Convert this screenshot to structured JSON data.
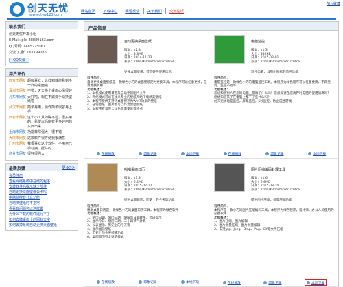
{
  "header": {
    "logo_name": "创天无忧",
    "logo_url": "www.ctwy123.com",
    "nav": [
      "网站首页",
      "下载中心",
      "问题反馈",
      "关于我们",
      "交流论坛"
    ],
    "join_label": "加入收藏"
  },
  "contact": {
    "title": "联系我们",
    "lines": [
      "创天无忧开发小组",
      "E-Mail: ple_88889163.com",
      "QQ号码: 1485225067",
      "交流QQ群: 167799086"
    ],
    "qq_button": "QQ交谈"
  },
  "reviews": {
    "title": "用户评价",
    "items": [
      {
        "name": "西安市网友",
        "text": "超级喜欢，这样到就能看到不一样的桌面啦"
      },
      {
        "name": "深圳市网友",
        "text": "不错，天天换个桌面心情很好"
      },
      {
        "name": "丹东市网友",
        "text": "太好啦，现在不需要手动换壁纸啦"
      },
      {
        "name": "武汉市网友",
        "text": "简单易用，操作简单很容易上手"
      },
      {
        "name": "西安市网友",
        "text": "这个小工具的确不错，很实用的，希望以后能有更多好用的东西出来"
      },
      {
        "name": "上海市网友",
        "text": "功能非常强大，很不错"
      },
      {
        "name": "大庆市网友",
        "text": "这款软件很方便我很满意"
      },
      {
        "name": "广州市网友",
        "text": "我很喜欢这个软件，不用自己手动换，挺好的"
      },
      {
        "name": "商业市网友",
        "text": "很好很强大"
      }
    ]
  },
  "feedback": {
    "title": "最新反馈",
    "more": "更多>>",
    "items": [
      "会员注册",
      "查看网络系统中在线的程序",
      "安装软件后提示缺少部件",
      "自动更换桌面壁纸会卡吗",
      "电脑监控有什么功能",
      "自动换壁纸时不正常",
      "看看有问题可以这样做",
      "为什么下载的软件运行不了",
      "如何去掉桌面上的图标文字",
      "如何去掉系统自动更换桌面壁纸"
    ]
  },
  "main": {
    "title": "产品信息",
    "products": [
      {
        "name": "自动更换桌面壁纸",
        "specs": [
          "版本：v2.3",
          "大小：3.8MB",
          "日期：2014-11-23",
          "系统：2000/XP/Vista/Win7/Win8"
        ],
        "tagline": "更换桌面壁纸，营造硬件使用信息",
        "desc_title": "程序简介：",
        "desc": "自动更换桌面壁纸是一款绿色小巧的桌面壁纸定时更换工具，本程序可以任意更换，任意更换所用",
        "feat_title": "功能概述：",
        "features": [
          "1、本机模式使用日志及自动更新图片文件",
          "2、网络模式可以在线从专业的壁纸网站下载精美壁纸",
          "3、本程序提供支持将桌面保存为Win7效果的壁纸",
          "4、任何壁纸、图片都可以作为桌面壁纸",
          "5、本程序有着完全绿色无需安装等特点"
        ],
        "actions": [
          "在线播放",
          "印象记录",
          "本地下载"
        ]
      },
      {
        "name": "电脑监控",
        "specs": [
          "版本：v1.3",
          "大小：832KB",
          "日期：2015-03-01",
          "系统：2000/XP/Vista/Win7/Win8"
        ],
        "tagline": "监控电脑，具有小图标的监控功能",
        "desc_title": "程序简介：",
        "desc": "电脑监控是一款绿色小巧的电脑监控工具，本程序为绿色程序可以任意更换，不再受到，监控不错等",
        "feat_title": "功能概述：",
        "features": [
          "您想知道别人在您的电脑上都做了什么吗？您想知道在您离开时电脑的使用情况吗？",
          "您想知道孩子在电脑上都干了些什么吗？",
          "创天无忧电脑监控，屏幕监控，5秒监控，防止沉迷游戏"
        ],
        "actions": [
          "在线播放",
          "印象记录",
          "本地下载"
        ]
      },
      {
        "name": "唱唱桌面日历",
        "specs": [
          "版本：v1.3",
          "大小：2.6MB",
          "日期：2015-02-17",
          "系统：2000/XP/Vista/Win7/Win8"
        ],
        "tagline": "提供桌面日历，历史上的今天等功能",
        "desc_title": "程序简介：",
        "desc": "唱唱桌面日历是一款绿色小巧的桌面日历工具，本程序为绿色软件",
        "feat_title": "功能概述：",
        "features": [
          "1、阴历日期、阳历日期、阴阳历日期转换，节日提示",
          "2、显示今日、阴历日期，二十四节气计算",
          "3、仪表显示、历史上的今天等",
          "4、显示当前壁纸",
          "5、历史上的今天提醒功能",
          "6、桌面日历有全透明模式"
        ],
        "actions": [
          "在线播放",
          "印象记录",
          "本地下载"
        ]
      },
      {
        "name": "图片压缩编码处理工具",
        "specs": [
          "版本：v1.6",
          "大小：2.6MB",
          "日期：2015-03-10",
          "系统：2000/XP/Vista/Win7/Win8"
        ],
        "tagline": "提供图片压缩，批量压缩功能",
        "desc_title": "程序简介：",
        "desc": "本程序是一款小巧的图片压缩编码工具，本程序为绿色程序，设计师，办公人员使用的必备软件",
        "feat_title": "功能概述：",
        "features": [
          "1、图片压缩，图片编辑",
          "2、图片批量压缩，图片批量编辑",
          "3、支持Jpg、Jpeg、Bmp、Png、Gif等文件压缩"
        ],
        "actions": [
          "在线播放",
          "印象记录",
          "本地下载"
        ]
      }
    ]
  }
}
